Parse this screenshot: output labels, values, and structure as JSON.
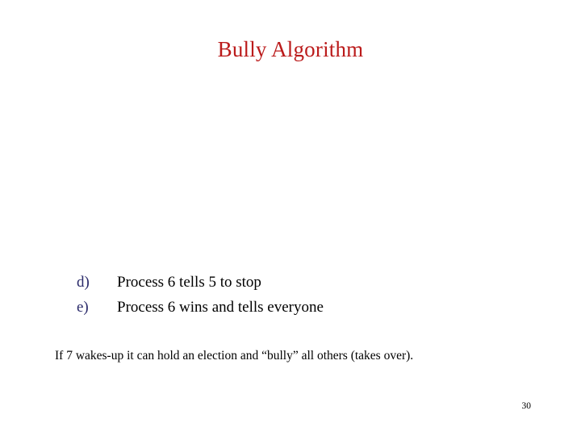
{
  "slide": {
    "title": "Bully Algorithm",
    "title_color": "#bb1b1b",
    "background_color": "#ffffff",
    "marker_color": "#2a2a6a",
    "body_color": "#000000",
    "steps": [
      {
        "marker": "d)",
        "text": "Process 6 tells 5 to stop"
      },
      {
        "marker": "e)",
        "text": "Process 6 wins and tells everyone"
      }
    ],
    "closing_note": "If 7 wakes-up it can hold an election and “bully” all others (takes over).",
    "page_number": "30"
  }
}
